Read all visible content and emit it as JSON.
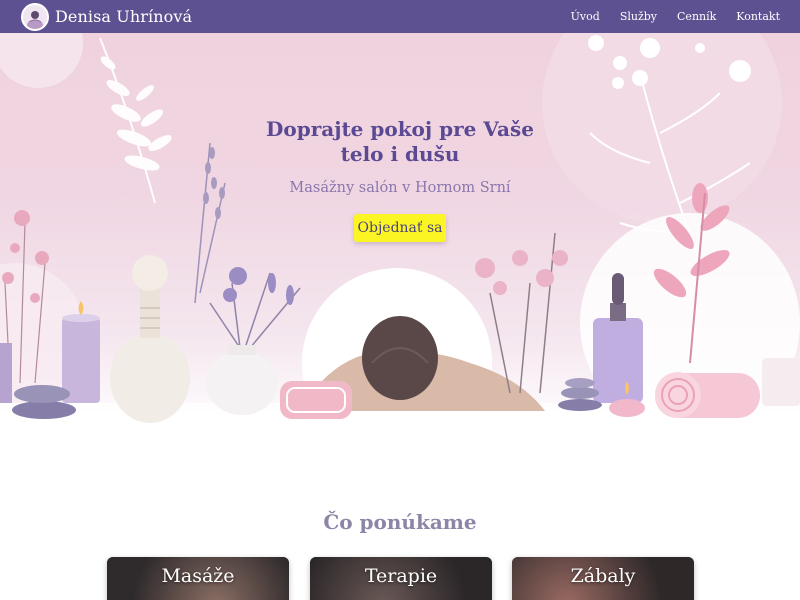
{
  "site": {
    "brand": "Denisa Uhrínová"
  },
  "nav": {
    "items": [
      {
        "label": "Úvod"
      },
      {
        "label": "Služby"
      },
      {
        "label": "Cenník"
      },
      {
        "label": "Kontakt"
      }
    ]
  },
  "hero": {
    "title_line1": "Doprajte pokoj pre Vaše",
    "title_line2": "telo i dušu",
    "subtitle": "Masážny salón v Hornom Srní",
    "cta_label": "Objednať sa"
  },
  "services": {
    "title": "Čo ponúkame",
    "cards": [
      {
        "label": "Masáže"
      },
      {
        "label": "Terapie"
      },
      {
        "label": "Zábaly"
      }
    ]
  },
  "colors": {
    "nav_bg": "#5e5191",
    "hero_bg": "#efd2de",
    "cta_bg": "#fbf523",
    "title_text": "#5b4a93"
  },
  "icons": {
    "logo": "logo-icon"
  }
}
